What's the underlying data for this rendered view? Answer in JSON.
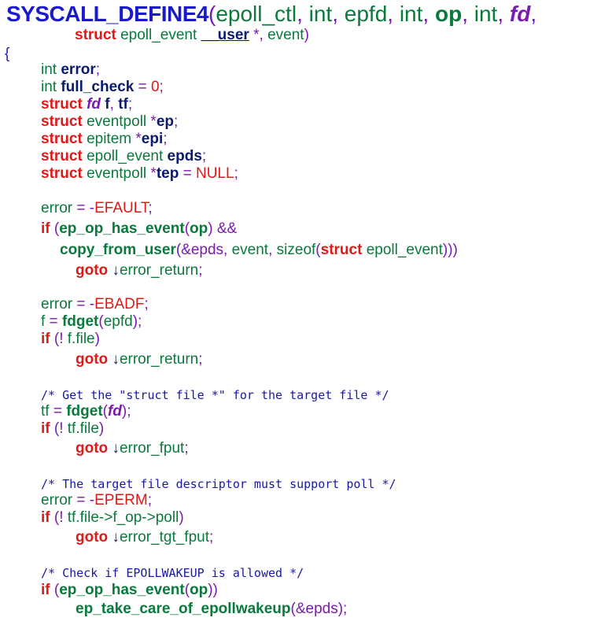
{
  "palette": {
    "keyword": "#e01818",
    "identifier": "#0a7a3c",
    "bold_name": "#0a1a6e",
    "punctuation": "#7a1ab0",
    "brace": "#1a1acc",
    "literal": "#e01818",
    "comment": "#1818a8",
    "header": "#1a1acc"
  },
  "lines": [
    {
      "segs": [
        {
          "t": "SYSCALL_DEFINE4",
          "c": "header",
          "b": 1,
          "big": 1
        },
        {
          "t": "(",
          "c": "punctuation"
        },
        {
          "t": "epoll_ctl",
          "c": "identifier"
        },
        {
          "t": ", ",
          "c": "punctuation"
        },
        {
          "t": "int",
          "c": "identifier"
        },
        {
          "t": ", ",
          "c": "punctuation"
        },
        {
          "t": "epfd",
          "c": "identifier"
        },
        {
          "t": ", ",
          "c": "punctuation"
        },
        {
          "t": "int",
          "c": "identifier"
        },
        {
          "t": ", ",
          "c": "punctuation"
        },
        {
          "t": "op",
          "c": "identifier",
          "b": 1
        },
        {
          "t": ", ",
          "c": "punctuation"
        },
        {
          "t": "int",
          "c": "identifier"
        },
        {
          "t": ", ",
          "c": "punctuation"
        },
        {
          "t": "fd",
          "c": "punctuation",
          "b": 1,
          "i": 1
        },
        {
          "t": ",",
          "c": "punctuation"
        }
      ]
    },
    {
      "segs": [
        {
          "t": "struct",
          "c": "keyword",
          "b": 1
        },
        {
          "t": " epoll_event ",
          "c": "identifier"
        },
        {
          "t": "__user",
          "c": "bold_name",
          "b": 1,
          "u": 1
        },
        {
          "t": " *",
          "c": "punctuation"
        },
        {
          "t": ", ",
          "c": "punctuation"
        },
        {
          "t": "event",
          "c": "identifier"
        },
        {
          "t": ")",
          "c": "punctuation"
        }
      ]
    },
    {
      "segs": [
        {
          "t": "{",
          "c": "brace"
        }
      ]
    },
    {
      "segs": [
        {
          "t": "int ",
          "c": "identifier"
        },
        {
          "t": "error",
          "c": "bold_name",
          "b": 1
        },
        {
          "t": ";",
          "c": "punctuation"
        }
      ]
    },
    {
      "segs": [
        {
          "t": "int ",
          "c": "identifier"
        },
        {
          "t": "full_check",
          "c": "bold_name",
          "b": 1
        },
        {
          "t": " = ",
          "c": "punctuation"
        },
        {
          "t": "0",
          "c": "literal"
        },
        {
          "t": ";",
          "c": "punctuation"
        }
      ]
    },
    {
      "segs": [
        {
          "t": "struct",
          "c": "keyword",
          "b": 1
        },
        {
          "t": " ",
          "c": "identifier"
        },
        {
          "t": "fd",
          "c": "punctuation",
          "b": 1,
          "i": 1
        },
        {
          "t": " ",
          "c": "identifier"
        },
        {
          "t": "f",
          "c": "bold_name",
          "b": 1
        },
        {
          "t": ", ",
          "c": "punctuation"
        },
        {
          "t": "tf",
          "c": "bold_name",
          "b": 1
        },
        {
          "t": ";",
          "c": "punctuation"
        }
      ]
    },
    {
      "segs": [
        {
          "t": "struct",
          "c": "keyword",
          "b": 1
        },
        {
          "t": " eventpoll ",
          "c": "identifier"
        },
        {
          "t": "*",
          "c": "punctuation"
        },
        {
          "t": "ep",
          "c": "bold_name",
          "b": 1
        },
        {
          "t": ";",
          "c": "punctuation"
        }
      ]
    },
    {
      "segs": [
        {
          "t": "struct",
          "c": "keyword",
          "b": 1
        },
        {
          "t": " epitem ",
          "c": "identifier"
        },
        {
          "t": "*",
          "c": "punctuation"
        },
        {
          "t": "epi",
          "c": "bold_name",
          "b": 1
        },
        {
          "t": ";",
          "c": "punctuation"
        }
      ]
    },
    {
      "segs": [
        {
          "t": "struct",
          "c": "keyword",
          "b": 1
        },
        {
          "t": " epoll_event ",
          "c": "identifier"
        },
        {
          "t": "epds",
          "c": "bold_name",
          "b": 1
        },
        {
          "t": ";",
          "c": "punctuation"
        }
      ]
    },
    {
      "segs": [
        {
          "t": "struct",
          "c": "keyword",
          "b": 1
        },
        {
          "t": " eventpoll ",
          "c": "identifier"
        },
        {
          "t": "*",
          "c": "punctuation"
        },
        {
          "t": "tep",
          "c": "bold_name",
          "b": 1
        },
        {
          "t": " = ",
          "c": "punctuation"
        },
        {
          "t": "NULL",
          "c": "literal"
        },
        {
          "t": ";",
          "c": "punctuation"
        }
      ]
    },
    {
      "segs": [
        {
          "t": "error",
          "c": "identifier"
        },
        {
          "t": " = -",
          "c": "punctuation"
        },
        {
          "t": "EFAULT",
          "c": "literal"
        },
        {
          "t": ";",
          "c": "punctuation"
        }
      ]
    },
    {
      "segs": [
        {
          "t": "if",
          "c": "keyword",
          "b": 1
        },
        {
          "t": " (",
          "c": "punctuation"
        },
        {
          "t": "ep_op_has_event",
          "c": "identifier",
          "b": 1
        },
        {
          "t": "(",
          "c": "punctuation"
        },
        {
          "t": "op",
          "c": "identifier",
          "b": 1
        },
        {
          "t": ") &&",
          "c": "punctuation"
        }
      ]
    },
    {
      "segs": [
        {
          "t": "copy_from_user",
          "c": "identifier",
          "b": 1
        },
        {
          "t": "(&",
          "c": "punctuation"
        },
        {
          "t": "epds",
          "c": "punctuation"
        },
        {
          "t": ", ",
          "c": "punctuation"
        },
        {
          "t": "event",
          "c": "identifier"
        },
        {
          "t": ", ",
          "c": "punctuation"
        },
        {
          "t": "sizeof",
          "c": "identifier"
        },
        {
          "t": "(",
          "c": "punctuation"
        },
        {
          "t": "struct",
          "c": "keyword",
          "b": 1
        },
        {
          "t": " epoll_event",
          "c": "identifier"
        },
        {
          "t": ")))",
          "c": "punctuation"
        }
      ]
    },
    {
      "segs": [
        {
          "t": "goto",
          "c": "keyword",
          "b": 1
        },
        {
          "t": " ↓",
          "c": "bold_name"
        },
        {
          "t": "error_return",
          "c": "identifier"
        },
        {
          "t": ";",
          "c": "punctuation"
        }
      ]
    },
    {
      "segs": [
        {
          "t": "error",
          "c": "identifier"
        },
        {
          "t": " = -",
          "c": "punctuation"
        },
        {
          "t": "EBADF",
          "c": "literal"
        },
        {
          "t": ";",
          "c": "punctuation"
        }
      ]
    },
    {
      "segs": [
        {
          "t": "f",
          "c": "identifier"
        },
        {
          "t": " = ",
          "c": "punctuation"
        },
        {
          "t": "fdget",
          "c": "identifier",
          "b": 1
        },
        {
          "t": "(",
          "c": "punctuation"
        },
        {
          "t": "epfd",
          "c": "identifier"
        },
        {
          "t": ");",
          "c": "punctuation"
        }
      ]
    },
    {
      "segs": [
        {
          "t": "if",
          "c": "keyword",
          "b": 1
        },
        {
          "t": " (! ",
          "c": "punctuation"
        },
        {
          "t": "f.file",
          "c": "identifier"
        },
        {
          "t": ")",
          "c": "punctuation"
        }
      ]
    },
    {
      "segs": [
        {
          "t": "goto",
          "c": "keyword",
          "b": 1
        },
        {
          "t": " ↓",
          "c": "bold_name"
        },
        {
          "t": "error_return",
          "c": "identifier"
        },
        {
          "t": ";",
          "c": "punctuation"
        }
      ]
    },
    {
      "segs": [
        {
          "t": "/* Get the \"struct file *\" for the target file */",
          "c": "comment",
          "m": 1
        }
      ]
    },
    {
      "segs": [
        {
          "t": "tf",
          "c": "identifier"
        },
        {
          "t": " = ",
          "c": "punctuation"
        },
        {
          "t": "fdget",
          "c": "identifier",
          "b": 1
        },
        {
          "t": "(",
          "c": "punctuation"
        },
        {
          "t": "fd",
          "c": "punctuation",
          "b": 1,
          "i": 1
        },
        {
          "t": ");",
          "c": "punctuation"
        }
      ]
    },
    {
      "segs": [
        {
          "t": "if",
          "c": "keyword",
          "b": 1
        },
        {
          "t": " (! ",
          "c": "punctuation"
        },
        {
          "t": "tf.file",
          "c": "identifier"
        },
        {
          "t": ")",
          "c": "punctuation"
        }
      ]
    },
    {
      "segs": [
        {
          "t": "goto",
          "c": "keyword",
          "b": 1
        },
        {
          "t": " ↓",
          "c": "bold_name"
        },
        {
          "t": "error_fput",
          "c": "identifier"
        },
        {
          "t": ";",
          "c": "punctuation"
        }
      ]
    },
    {
      "segs": [
        {
          "t": "/* The target file descriptor must support poll */",
          "c": "comment",
          "m": 1
        }
      ]
    },
    {
      "segs": [
        {
          "t": "error",
          "c": "identifier"
        },
        {
          "t": " = -",
          "c": "punctuation"
        },
        {
          "t": "EPERM",
          "c": "literal"
        },
        {
          "t": ";",
          "c": "punctuation"
        }
      ]
    },
    {
      "segs": [
        {
          "t": "if",
          "c": "keyword",
          "b": 1
        },
        {
          "t": " (! ",
          "c": "punctuation"
        },
        {
          "t": "tf.file->f_op->poll",
          "c": "identifier"
        },
        {
          "t": ")",
          "c": "punctuation"
        }
      ]
    },
    {
      "segs": [
        {
          "t": "goto",
          "c": "keyword",
          "b": 1
        },
        {
          "t": " ↓",
          "c": "bold_name"
        },
        {
          "t": "error_tgt_fput",
          "c": "identifier"
        },
        {
          "t": ";",
          "c": "punctuation"
        }
      ]
    },
    {
      "segs": [
        {
          "t": "/* Check if EPOLLWAKEUP is allowed */",
          "c": "comment",
          "m": 1
        }
      ]
    },
    {
      "segs": [
        {
          "t": "if",
          "c": "keyword",
          "b": 1
        },
        {
          "t": " (",
          "c": "punctuation"
        },
        {
          "t": "ep_op_has_event",
          "c": "identifier",
          "b": 1
        },
        {
          "t": "(",
          "c": "punctuation"
        },
        {
          "t": "op",
          "c": "identifier",
          "b": 1
        },
        {
          "t": "))",
          "c": "punctuation"
        }
      ]
    },
    {
      "segs": [
        {
          "t": "ep_take_care_of_epollwakeup",
          "c": "identifier",
          "b": 1
        },
        {
          "t": "(&",
          "c": "punctuation"
        },
        {
          "t": "epds",
          "c": "punctuation"
        },
        {
          "t": ");",
          "c": "punctuation"
        }
      ]
    }
  ]
}
